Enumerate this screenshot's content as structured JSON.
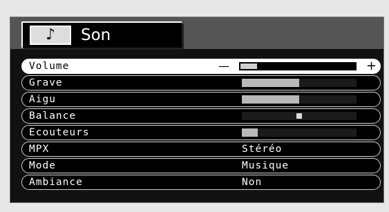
{
  "menu": {
    "title": "Son",
    "icon": "music-note-icon",
    "icon_glyph": "♪"
  },
  "rows": [
    {
      "label": "Volume",
      "type": "slider",
      "value": 0.14,
      "selected": true,
      "minus": "—",
      "plus": "+"
    },
    {
      "label": "Grave",
      "type": "slider",
      "value": 0.5
    },
    {
      "label": "Aigu",
      "type": "slider",
      "value": 0.5
    },
    {
      "label": "Balance",
      "type": "balance",
      "value": 0.5
    },
    {
      "label": "Ecouteurs",
      "type": "slider",
      "value": 0.14
    },
    {
      "label": "MPX",
      "type": "option",
      "value": "Stéréo"
    },
    {
      "label": "Mode",
      "type": "option",
      "value": "Musique"
    },
    {
      "label": "Ambiance",
      "type": "option",
      "value": "Non"
    }
  ],
  "colors": {
    "background": "#e7e7e7",
    "panel": "#111111",
    "header_band": "#555555",
    "selected_row": "#ffffff",
    "bar_fill": "#b9b9b9"
  }
}
